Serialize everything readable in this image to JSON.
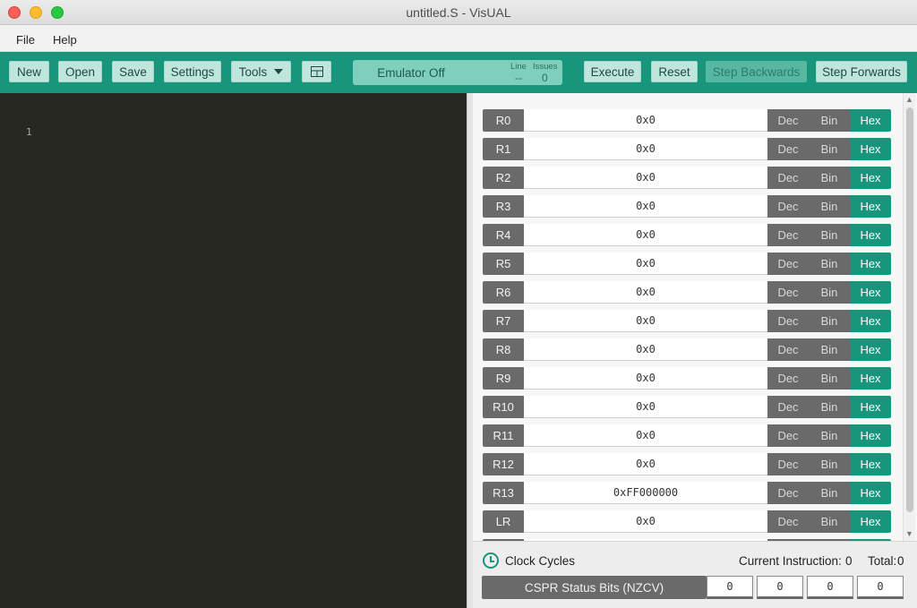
{
  "window": {
    "title": "untitled.S - VisUAL"
  },
  "menu": {
    "file": "File",
    "help": "Help"
  },
  "toolbar": {
    "new": "New",
    "open": "Open",
    "save": "Save",
    "settings": "Settings",
    "tools": "Tools",
    "emulator_status": "Emulator Off",
    "line_label": "Line",
    "line_value": "--",
    "issues_label": "Issues",
    "issues_value": "0",
    "execute": "Execute",
    "reset": "Reset",
    "step_backwards": "Step Backwards",
    "step_forwards": "Step Forwards"
  },
  "editor": {
    "line_numbers": [
      "1"
    ]
  },
  "registers": [
    {
      "name": "R0",
      "value": "0x0"
    },
    {
      "name": "R1",
      "value": "0x0"
    },
    {
      "name": "R2",
      "value": "0x0"
    },
    {
      "name": "R3",
      "value": "0x0"
    },
    {
      "name": "R4",
      "value": "0x0"
    },
    {
      "name": "R5",
      "value": "0x0"
    },
    {
      "name": "R6",
      "value": "0x0"
    },
    {
      "name": "R7",
      "value": "0x0"
    },
    {
      "name": "R8",
      "value": "0x0"
    },
    {
      "name": "R9",
      "value": "0x0"
    },
    {
      "name": "R10",
      "value": "0x0"
    },
    {
      "name": "R11",
      "value": "0x0"
    },
    {
      "name": "R12",
      "value": "0x0"
    },
    {
      "name": "R13",
      "value": "0xFF000000"
    },
    {
      "name": "LR",
      "value": "0x0"
    }
  ],
  "register_modes": {
    "dec": "Dec",
    "bin": "Bin",
    "hex": "Hex",
    "selected": "Hex"
  },
  "status": {
    "clock_cycles_label": "Clock Cycles",
    "current_instruction_label": "Current Instruction:",
    "current_instruction_value": "0",
    "total_label": "Total:",
    "total_value": "0",
    "cspr_label": "CSPR Status Bits (NZCV)",
    "flags": [
      "0",
      "0",
      "0",
      "0"
    ]
  },
  "colors": {
    "accent": "#17967c",
    "editor_bg": "#272822",
    "register_bg": "#6a6a6a"
  }
}
